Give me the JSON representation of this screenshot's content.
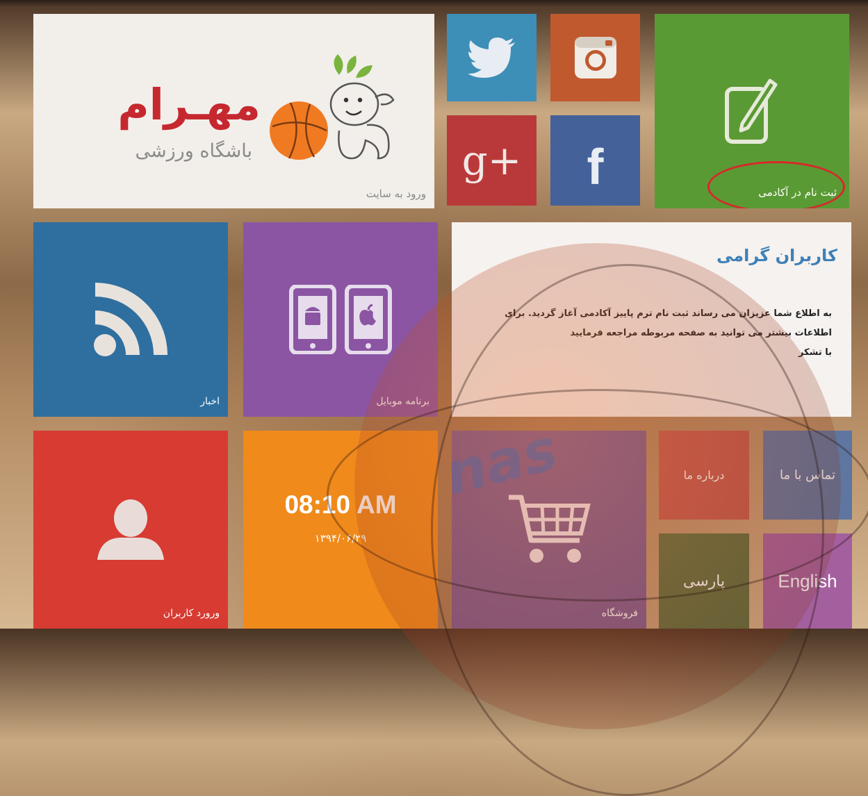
{
  "logo": {
    "title": "مهـرام",
    "subtitle": "باشگاه ورزشی",
    "enter_label": "ورود به سایت"
  },
  "social": {
    "twitter_icon": "twitter-icon",
    "instagram_icon": "instagram-icon",
    "gplus_text": "g+",
    "facebook_text": "f"
  },
  "register": {
    "label": "ثبت نام در آکادمی",
    "icon": "edit-icon",
    "highlight_color": "#d8282a"
  },
  "news": {
    "label": "اخبار",
    "icon": "rss-icon"
  },
  "mobile": {
    "label": "برنامه موبایل",
    "icon": "mobile-apps-icon"
  },
  "notice": {
    "title": "کاربران گرامی",
    "line1": "به اطلاع شما عزیزان می رساند ثبت نام ترم پاییز آکادمی آغاز گردید. برای",
    "line2": "اطلاعات بیشتر می توانید به صفحه مربوطه مراجعه فرمایید",
    "line3": "با تشکر"
  },
  "users": {
    "label": "ورورد کاربران",
    "icon": "user-icon"
  },
  "clock": {
    "time": "08:10 AM",
    "date": "۱۳۹۴/۰۶/۲۹"
  },
  "shop": {
    "label": "فروشگاه",
    "icon": "shopping-cart-icon"
  },
  "about": {
    "label": "درباره ما"
  },
  "contact": {
    "label": "تماس با ما"
  },
  "lang": {
    "persian": "پارسی",
    "english": "English"
  },
  "background_text": "nas",
  "colors": {
    "twitter": "#3d8fb8",
    "instagram": "#c0592e",
    "gplus": "#b9393a",
    "facebook": "#44619a",
    "register": "#5a9a34",
    "news": "#2e6f9f",
    "mobile": "#8b55a3",
    "users": "#d73b32",
    "clock": "#f08a1b",
    "brand_red": "#c6282f",
    "notice_title": "#3e80b8"
  }
}
